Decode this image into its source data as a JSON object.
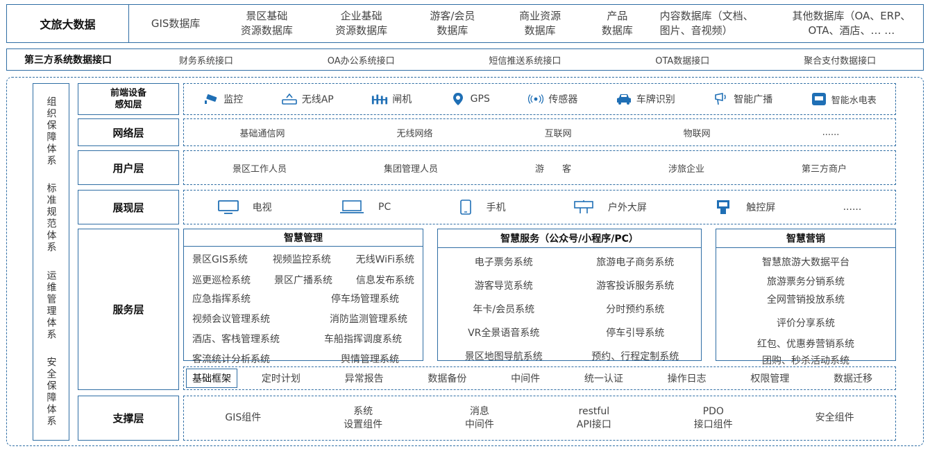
{
  "top": {
    "label": "文旅大数据",
    "items": [
      {
        "l1": "GIS数据库",
        "l2": ""
      },
      {
        "l1": "景区基础",
        "l2": "资源数据库"
      },
      {
        "l1": "企业基础",
        "l2": "资源数据库"
      },
      {
        "l1": "游客/会员",
        "l2": "数据库"
      },
      {
        "l1": "商业资源",
        "l2": "数据库"
      },
      {
        "l1": "产品",
        "l2": "数据库"
      },
      {
        "l1": "内容数据库（文档、",
        "l2": "图片、音视频）"
      },
      {
        "l1": "其他数据库（OA、ERP、",
        "l2": "OTA、酒店、… …"
      }
    ]
  },
  "third": {
    "label": "第三方系统数据接口",
    "items": [
      "财务系统接口",
      "OA办公系统接口",
      "短信推送系统接口",
      "OTA数据接口",
      "聚合支付数据接口"
    ]
  },
  "side": {
    "groups": [
      "组织保障体系",
      "标准规范体系",
      "运维管理体系",
      "安全保障体系"
    ]
  },
  "layers": {
    "device": {
      "label_l1": "前端设备",
      "label_l2": "感知层",
      "items": [
        {
          "icon": "camera-icon",
          "text": "监控"
        },
        {
          "icon": "wireless-ap-icon",
          "text": "无线AP"
        },
        {
          "icon": "gate-icon",
          "text": "闸机"
        },
        {
          "icon": "gps-pin-icon",
          "text": "GPS"
        },
        {
          "icon": "sensor-icon",
          "text": "传感器"
        },
        {
          "icon": "car-icon",
          "text": "车牌识别"
        },
        {
          "icon": "broadcast-icon",
          "text": "智能广播"
        },
        {
          "icon": "meter-icon",
          "text": "智能水电表"
        }
      ]
    },
    "network": {
      "label": "网络层",
      "items": [
        "基础通信网",
        "无线网络",
        "互联网",
        "物联网",
        "......"
      ]
    },
    "user": {
      "label": "用户层",
      "items": [
        "景区工作人员",
        "集团管理人员",
        "游　　客",
        "涉旅企业",
        "第三方商户"
      ]
    },
    "display": {
      "label": "展现层",
      "items": [
        {
          "icon": "tv-icon",
          "text": "电视"
        },
        {
          "icon": "pc-icon",
          "text": "PC"
        },
        {
          "icon": "phone-icon",
          "text": "手机"
        },
        {
          "icon": "outdoor-screen-icon",
          "text": "户外大屏"
        },
        {
          "icon": "touchscreen-icon",
          "text": "触控屏"
        },
        {
          "icon": "",
          "text": "......"
        }
      ]
    },
    "service": {
      "label": "服务层",
      "mgmt": {
        "title": "智慧管理",
        "rows": [
          [
            "景区GIS系统",
            "视频监控系统",
            "无线WiFi系统"
          ],
          [
            "巡更巡检系统",
            "景区广播系统",
            "信息发布系统"
          ],
          [
            "应急指挥系统",
            "停车场管理系统"
          ],
          [
            "视频会议管理系统",
            "消防监测管理系统"
          ],
          [
            "酒店、客栈管理系统",
            "车船指挥调度系统"
          ],
          [
            "客流统计分析系统",
            "舆情管理系统"
          ]
        ]
      },
      "svc": {
        "title": "智慧服务（公众号/小程序/PC）",
        "rows": [
          [
            "电子票务系统",
            "旅游电子商务系统"
          ],
          [
            "游客导览系统",
            "游客投诉服务系统"
          ],
          [
            "年卡/会员系统",
            "分时预约系统"
          ],
          [
            "VR全景语音系统",
            "停车引导系统"
          ],
          [
            "景区地图导航系统",
            "预约、行程定制系统"
          ]
        ]
      },
      "mkt": {
        "title": "智慧营销",
        "items": [
          "智慧旅游大数据平台",
          "旅游票务分销系统",
          "全网营销投放系统",
          "评价分享系统",
          "红包、优惠券营销系统",
          "团购、秒杀活动系统"
        ]
      },
      "base": {
        "label": "基础框架",
        "items": [
          "定时计划",
          "异常报告",
          "数据备份",
          "中间件",
          "统一认证",
          "操作日志",
          "权限管理",
          "数据迁移"
        ]
      }
    },
    "support": {
      "label": "支撑层",
      "items": [
        {
          "l1": "GIS组件",
          "l2": ""
        },
        {
          "l1": "系统",
          "l2": "设置组件"
        },
        {
          "l1": "消息",
          "l2": "中间件"
        },
        {
          "l1": "restful",
          "l2": "API接口"
        },
        {
          "l1": "PDO",
          "l2": "接口组件"
        },
        {
          "l1": "安全组件",
          "l2": ""
        }
      ]
    }
  },
  "colors": {
    "border": "#2e6da4",
    "icon": "#1f6fb5"
  }
}
